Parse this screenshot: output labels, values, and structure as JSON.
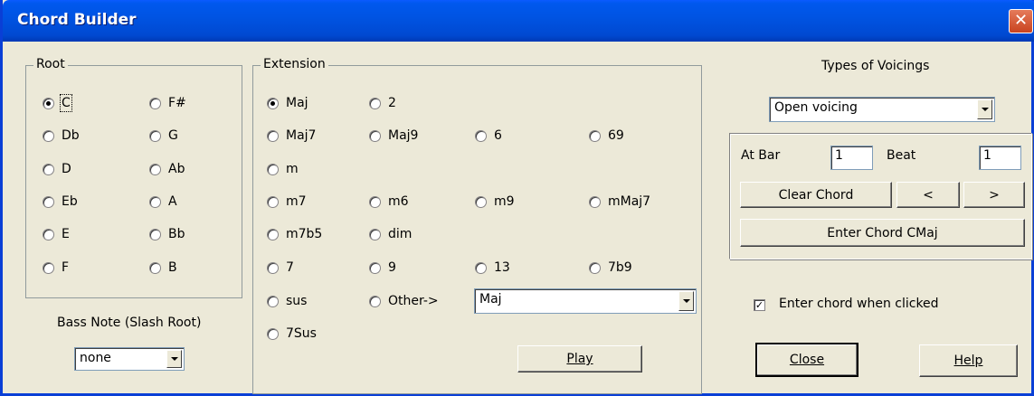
{
  "window": {
    "title": "Chord Builder",
    "close_glyph": "✕"
  },
  "root": {
    "legend": "Root",
    "options": [
      "C",
      "Db",
      "D",
      "Eb",
      "E",
      "F",
      "F#",
      "G",
      "Ab",
      "A",
      "Bb",
      "B"
    ],
    "selected": "C"
  },
  "bass_note": {
    "label": "Bass Note (Slash Root)",
    "value": "none"
  },
  "extension": {
    "legend": "Extension",
    "options": [
      "Maj",
      "2",
      "Maj7",
      "Maj9",
      "6",
      "69",
      "m",
      "m7",
      "m6",
      "m9",
      "mMaj7",
      "m7b5",
      "dim",
      "7",
      "9",
      "13",
      "7b9",
      "sus",
      "Other->",
      "7Sus"
    ],
    "selected": "Maj",
    "other_value": "Maj",
    "play_label": "Play"
  },
  "voicings": {
    "label": "Types of Voicings",
    "value": "Open voicing"
  },
  "position": {
    "at_bar_label": "At Bar",
    "bar_value": "1",
    "beat_label": "Beat",
    "beat_value": "1",
    "clear_label": "Clear Chord",
    "prev_label": "<",
    "next_label": ">",
    "enter_label": "Enter Chord CMaj"
  },
  "enter_when_clicked": {
    "label": "Enter chord when clicked",
    "checked": true,
    "check_glyph": "✓"
  },
  "buttons": {
    "close": "Close",
    "help": "Help"
  },
  "icons": {
    "radio": "radio-button",
    "dropdown": "chevron-down-icon"
  }
}
